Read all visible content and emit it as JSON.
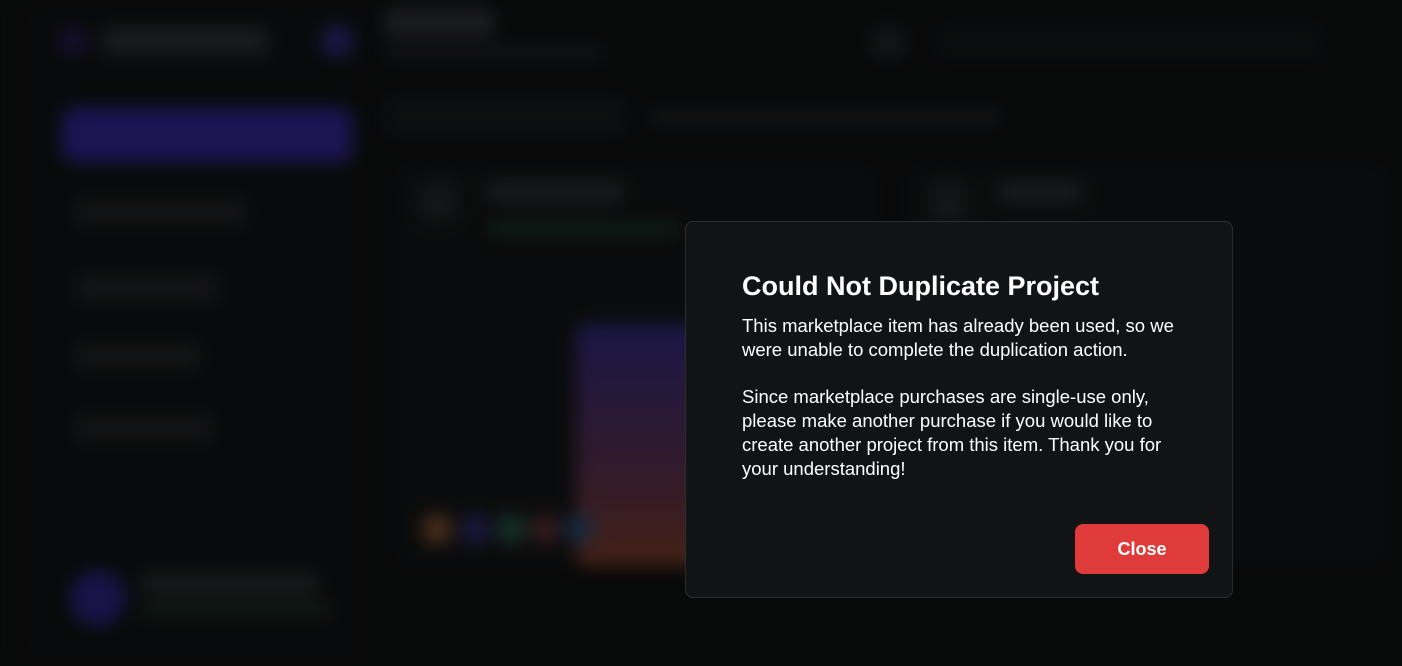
{
  "dialog": {
    "title": "Could Not Duplicate Project",
    "message_1": "This marketplace item has already been used, so we were unable to complete the duplication action.",
    "message_2": "Since marketplace purchases are single-use only, please make another purchase if you would like to create another project from this item. Thank you for your understanding!",
    "close_label": "Close"
  },
  "colors": {
    "close_button": "#e03b3b",
    "dialog_background": "#121315",
    "accent": "#3a2bc4"
  }
}
